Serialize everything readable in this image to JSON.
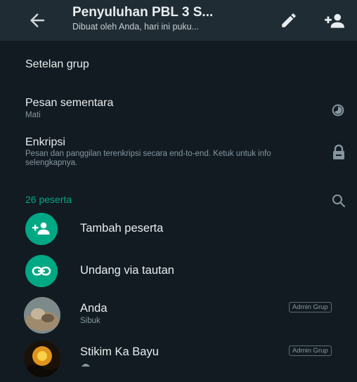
{
  "header": {
    "title": "Penyuluhan PBL 3 S...",
    "subtitle": "Dibuat oleh Anda, hari ini puku...",
    "back_icon": "arrow-left-icon",
    "edit_icon": "pencil-icon",
    "add_icon": "add-participant-icon"
  },
  "settings": {
    "label": "Setelan grup"
  },
  "privacy": {
    "disappearing": {
      "label": "Pesan sementara",
      "value": "Mati",
      "icon": "timer-icon"
    },
    "encryption": {
      "label": "Enkripsi",
      "description": "Pesan dan panggilan terenkripsi secara end-to-end. Ketuk untuk info selengkapnya.",
      "icon": "lock-icon"
    }
  },
  "participants": {
    "count_label": "26 peserta",
    "search_icon": "search-icon",
    "actions": {
      "add_label": "Tambah peserta",
      "invite_label": "Undang via tautan"
    },
    "members": [
      {
        "name": "Anda",
        "status": "Sibuk",
        "badge": "Admin Grup"
      },
      {
        "name": "Stikim Ka Bayu",
        "status": "",
        "badge": "Admin Grup"
      }
    ]
  },
  "colors": {
    "accent": "#00a884",
    "background": "#121b22",
    "header": "#1f2c34"
  }
}
